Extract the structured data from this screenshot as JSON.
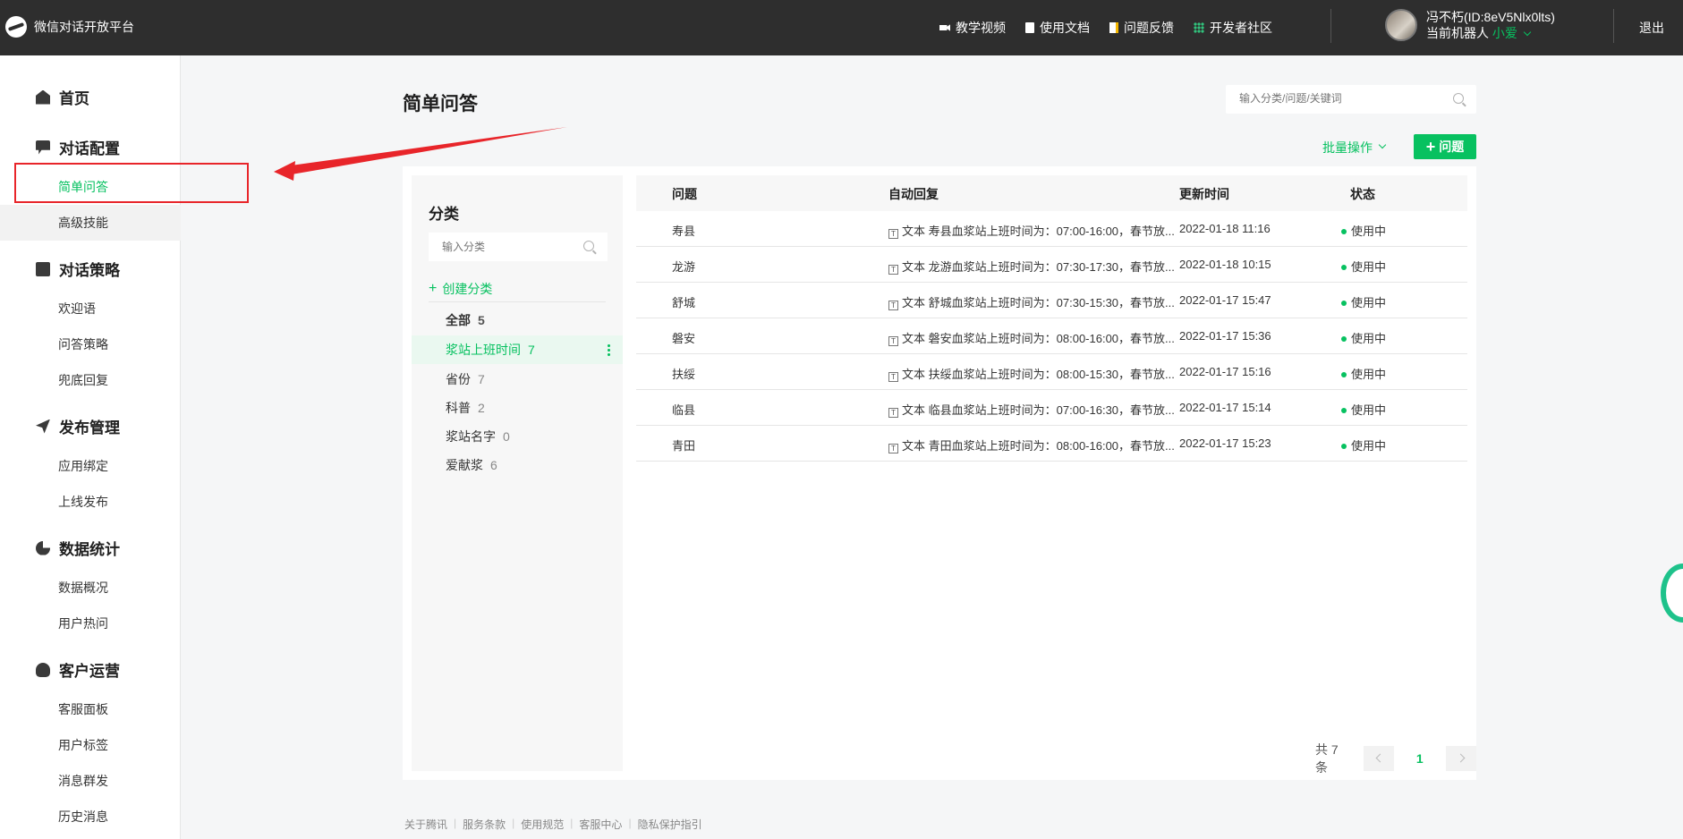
{
  "app": {
    "title": "微信对话开放平台"
  },
  "topnav": [
    {
      "label": "教学视频",
      "icon": "video-icon"
    },
    {
      "label": "使用文档",
      "icon": "document-icon"
    },
    {
      "label": "问题反馈",
      "icon": "feedback-icon"
    },
    {
      "label": "开发者社区",
      "icon": "community-icon"
    }
  ],
  "user": {
    "name": "冯不朽(ID:8eV5Nlx0lts)",
    "robot_prefix": "当前机器人",
    "robot_name": "小爱"
  },
  "logout": "退出",
  "sidebar": {
    "sections": [
      {
        "title": "首页"
      },
      {
        "title": "对话配置",
        "items": [
          "简单问答",
          "高级技能"
        ]
      },
      {
        "title": "对话策略",
        "items": [
          "欢迎语",
          "问答策略",
          "兜底回复"
        ]
      },
      {
        "title": "发布管理",
        "items": [
          "应用绑定",
          "上线发布"
        ]
      },
      {
        "title": "数据统计",
        "items": [
          "数据概况",
          "用户热问"
        ]
      },
      {
        "title": "客户运营",
        "items": [
          "客服面板",
          "用户标签",
          "消息群发",
          "历史消息"
        ]
      }
    ]
  },
  "main": {
    "title": "简单问答",
    "search_placeholder": "输入分类/问题/关键词",
    "batch_label": "批量操作",
    "add_label": "问题"
  },
  "categories": {
    "title": "分类",
    "search_placeholder": "输入分类",
    "create_label": "创建分类",
    "items": [
      {
        "name": "全部",
        "count": "5"
      },
      {
        "name": "浆站上班时间",
        "count": "7"
      },
      {
        "name": "省份",
        "count": "7"
      },
      {
        "name": "科普",
        "count": "2"
      },
      {
        "name": "浆站名字",
        "count": "0"
      },
      {
        "name": "爱献浆",
        "count": "6"
      }
    ]
  },
  "table": {
    "headers": [
      "问题",
      "自动回复",
      "更新时间",
      "状态"
    ],
    "reply_type": "文本",
    "rows": [
      {
        "q": "寿县",
        "reply": "寿县血浆站上班时间为：07:00-16:00，春节放...",
        "time": "2022-01-18 11:16",
        "status": "使用中"
      },
      {
        "q": "龙游",
        "reply": "龙游血浆站上班时间为：07:30-17:30，春节放...",
        "time": "2022-01-18 10:15",
        "status": "使用中"
      },
      {
        "q": "舒城",
        "reply": "舒城血浆站上班时间为：07:30-15:30，春节放...",
        "time": "2022-01-17 15:47",
        "status": "使用中"
      },
      {
        "q": "磐安",
        "reply": "磐安血浆站上班时间为：08:00-16:00，春节放...",
        "time": "2022-01-17 15:36",
        "status": "使用中"
      },
      {
        "q": "扶绥",
        "reply": "扶绥血浆站上班时间为：08:00-15:30，春节放...",
        "time": "2022-01-17 15:16",
        "status": "使用中"
      },
      {
        "q": "临县",
        "reply": "临县血浆站上班时间为：07:00-16:30，春节放...",
        "time": "2022-01-17 15:14",
        "status": "使用中"
      },
      {
        "q": "青田",
        "reply": "青田血浆站上班时间为：08:00-16:00，春节放...",
        "time": "2022-01-17 15:23",
        "status": "使用中"
      }
    ]
  },
  "pager": {
    "total": "共 7 条",
    "page": "1"
  },
  "footer": [
    "关于腾讯",
    "服务条款",
    "使用规范",
    "客服中心",
    "隐私保护指引"
  ],
  "colors": {
    "accent": "#07c160",
    "topbar": "#2e2e2e",
    "annotation": "#e8252a"
  }
}
